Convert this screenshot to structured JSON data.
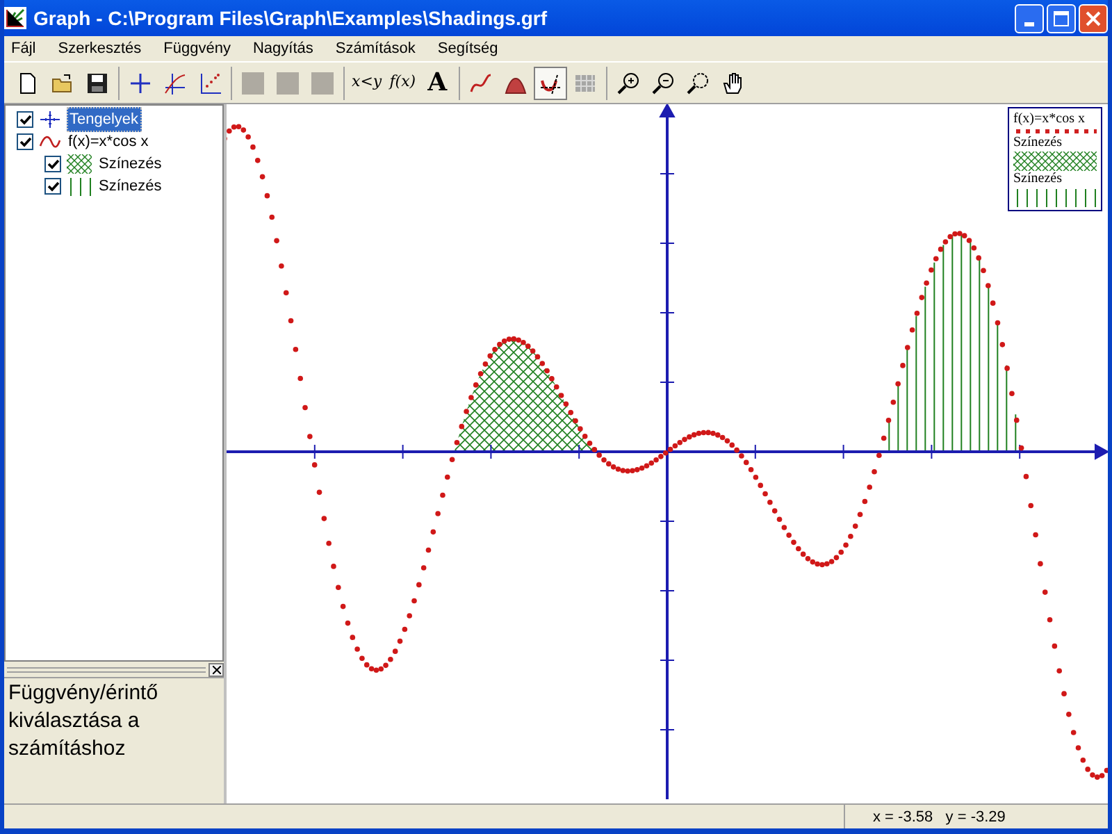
{
  "window": {
    "title": "Graph - C:\\Program Files\\Graph\\Examples\\Shadings.grf"
  },
  "menu": [
    "Fájl",
    "Szerkesztés",
    "Függvény",
    "Nagyítás",
    "Számítások",
    "Segítség"
  ],
  "toolbar": [
    [
      {
        "kind": "new",
        "disabled": false,
        "pressed": false
      },
      {
        "kind": "open",
        "disabled": false,
        "pressed": false
      },
      {
        "kind": "save",
        "disabled": false,
        "pressed": false
      }
    ],
    [
      {
        "kind": "axes",
        "disabled": false,
        "pressed": false
      },
      {
        "kind": "function",
        "disabled": false,
        "pressed": false
      },
      {
        "kind": "points",
        "disabled": false,
        "pressed": false
      }
    ],
    [
      {
        "kind": "blank",
        "disabled": true,
        "pressed": false
      },
      {
        "kind": "blank",
        "disabled": true,
        "pressed": false
      },
      {
        "kind": "blank",
        "disabled": true,
        "pressed": false
      }
    ],
    [
      {
        "kind": "text",
        "label": "x<y",
        "disabled": false,
        "pressed": false
      },
      {
        "kind": "text",
        "label": "f(x)",
        "disabled": false,
        "pressed": false
      },
      {
        "kind": "bigtext",
        "label": "A",
        "disabled": false,
        "pressed": false
      }
    ],
    [
      {
        "kind": "curve",
        "disabled": false,
        "pressed": false
      },
      {
        "kind": "shade",
        "disabled": false,
        "pressed": false
      },
      {
        "kind": "tangent",
        "disabled": false,
        "pressed": true
      },
      {
        "kind": "table",
        "disabled": true,
        "pressed": false
      }
    ],
    [
      {
        "kind": "zoomin",
        "disabled": false,
        "pressed": false
      },
      {
        "kind": "zoomout",
        "disabled": false,
        "pressed": false
      },
      {
        "kind": "zoombox",
        "disabled": false,
        "pressed": false
      },
      {
        "kind": "hand",
        "disabled": false,
        "pressed": false
      }
    ]
  ],
  "tree": [
    {
      "kind": "axes",
      "label": "Tengelyek",
      "checked": true,
      "selected": true
    },
    {
      "kind": "function",
      "label": "f(x)=x*cos x",
      "checked": true,
      "selected": false,
      "children": [
        {
          "kind": "hatch",
          "label": "Színezés",
          "checked": true,
          "selected": false
        },
        {
          "kind": "vertical",
          "label": "Színezés",
          "checked": true,
          "selected": false
        }
      ]
    }
  ],
  "hint": "Függvény/érintő kiválasztása a számításhoz",
  "legend": [
    {
      "kind": "line",
      "label": "f(x)=x*cos x"
    },
    {
      "kind": "hatch",
      "label": "Színezés"
    },
    {
      "kind": "vertical",
      "label": "Színezés"
    }
  ],
  "status": {
    "coords": "x = -3.58   y = -3.29"
  }
}
